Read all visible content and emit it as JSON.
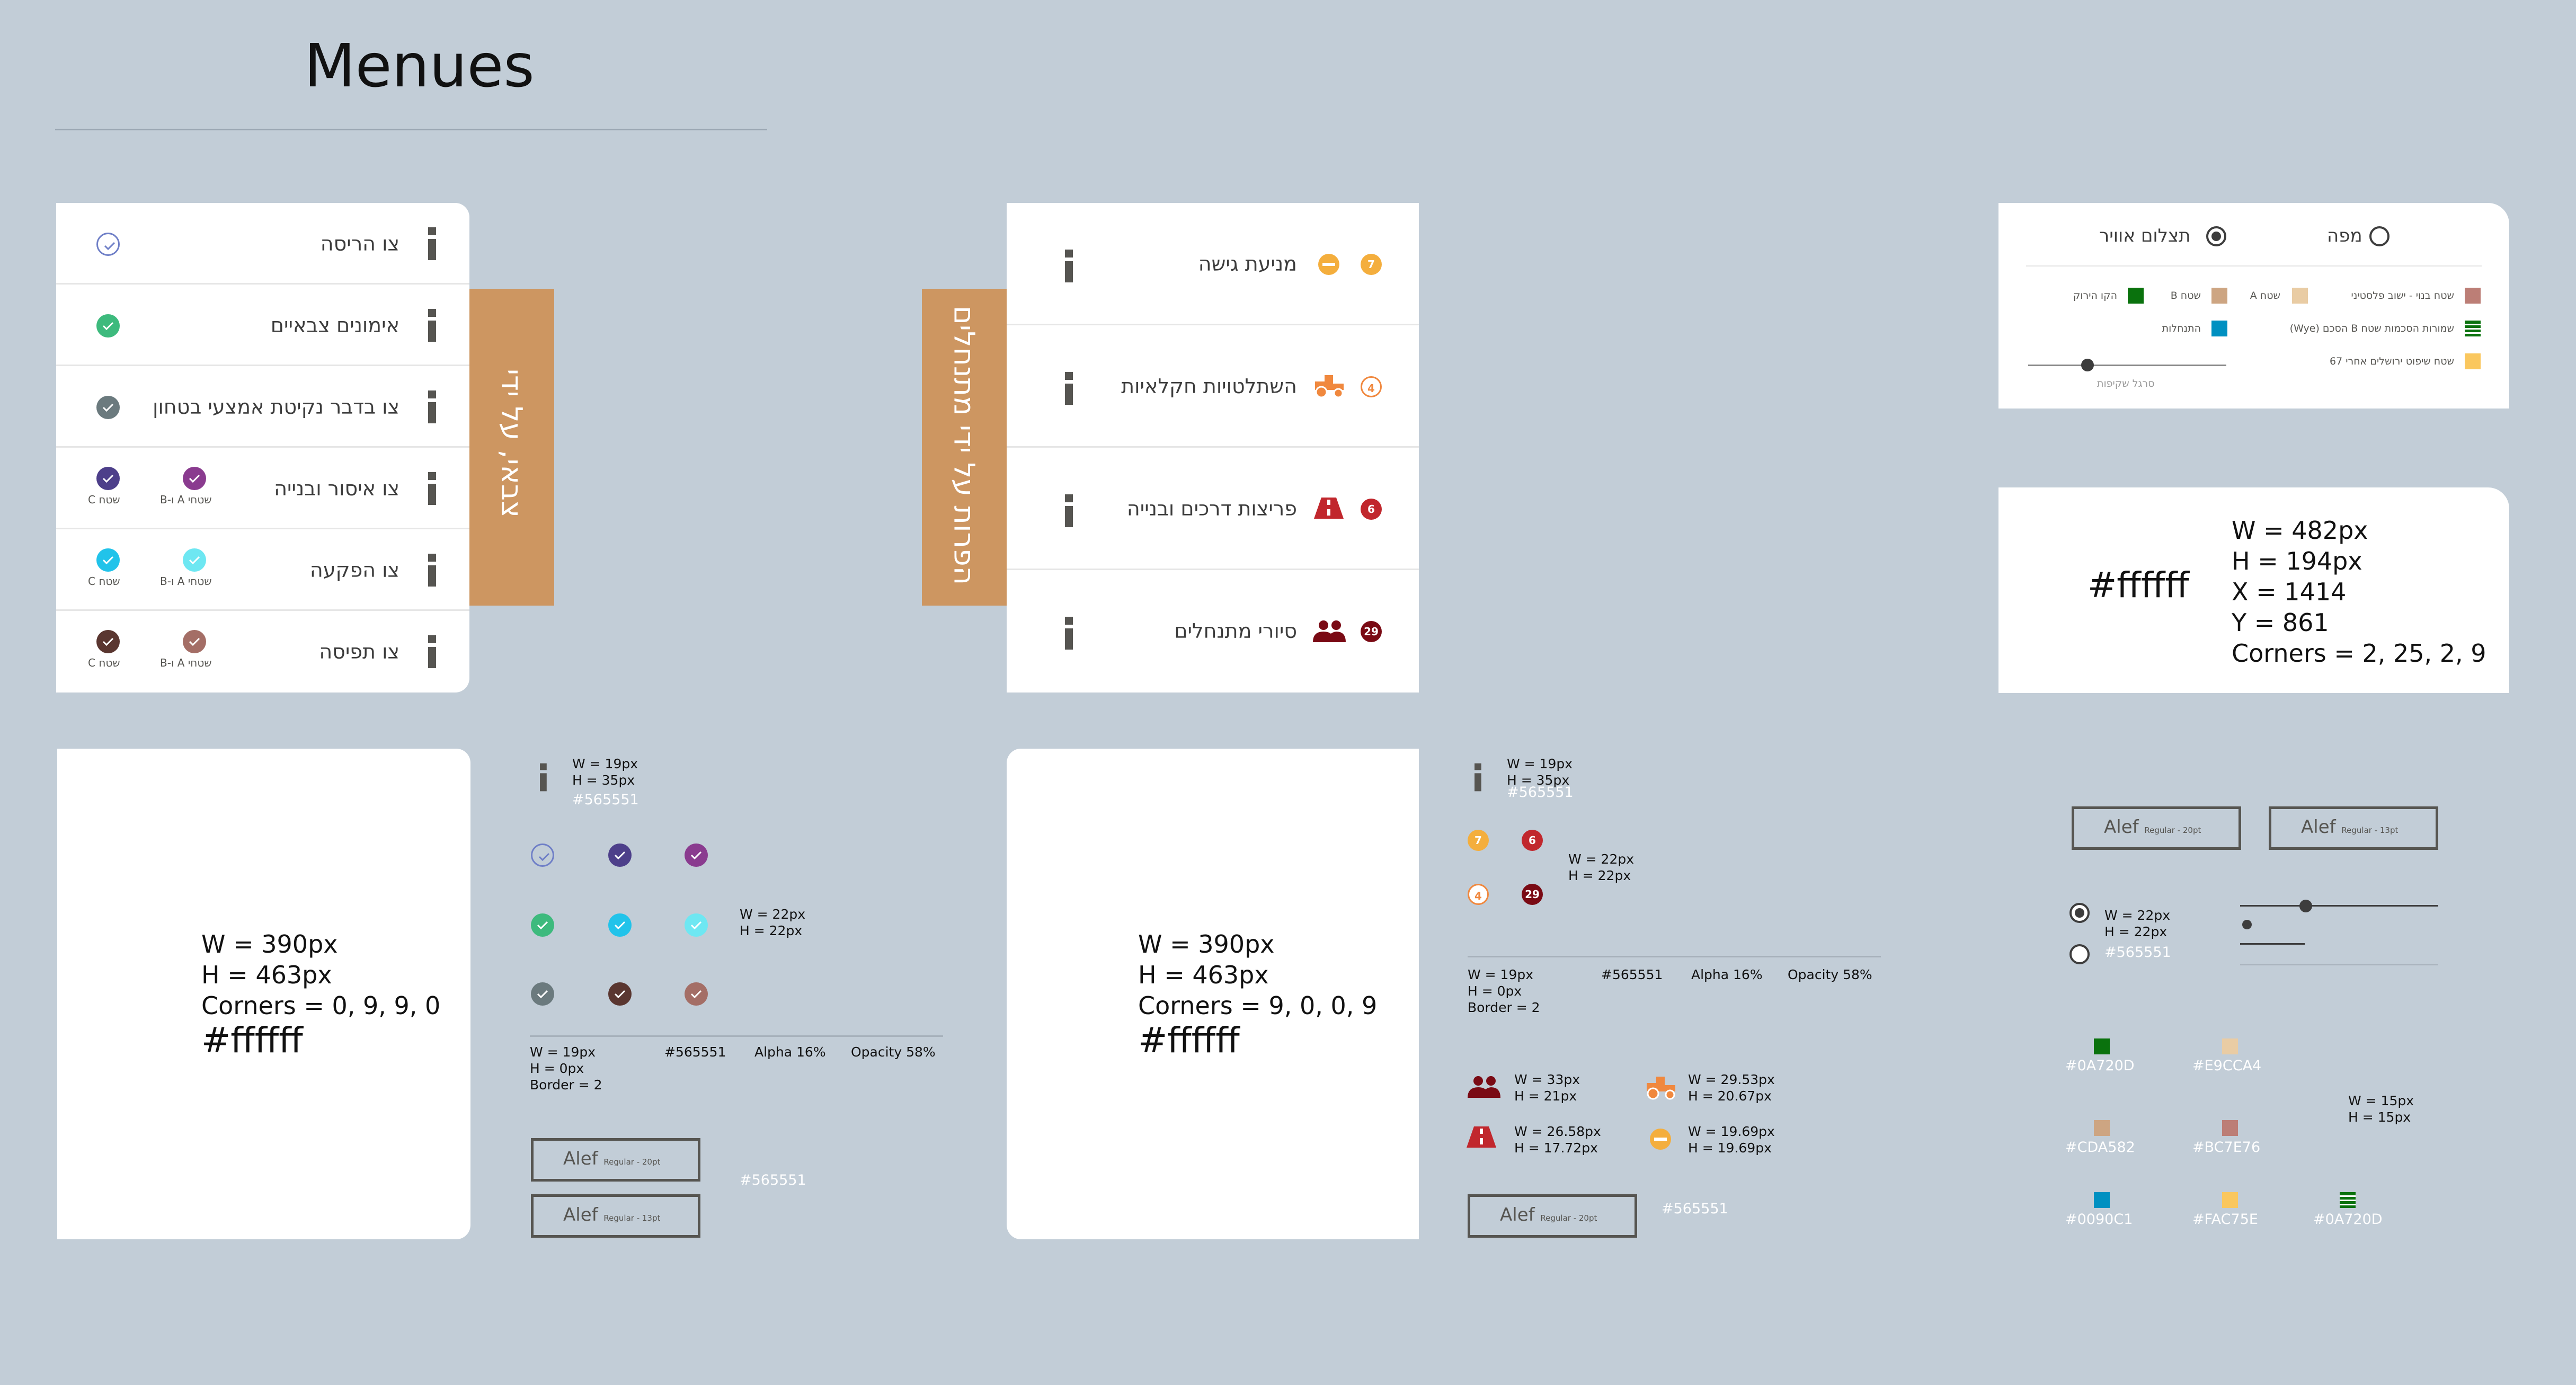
{
  "page": {
    "title": "Menues"
  },
  "menu1": {
    "tab_label": "צבאי, על ידי",
    "rows": [
      {
        "label": "צו הריסה",
        "icon": "check-outline-icon"
      },
      {
        "label": "אימונים צבאיים",
        "icon": "check-green-icon"
      },
      {
        "label": "צו בדבר נקיטת אמצעי בטחון",
        "icon": "check-gray-icon"
      },
      {
        "label": "צו איסור ובנייה",
        "sub_a": "שטחי A ו-B",
        "sub_c": "שטח C"
      },
      {
        "label": "צו הפקעה",
        "sub_a": "שטחי A ו-B",
        "sub_c": "שטח C"
      },
      {
        "label": "צו תפיסה",
        "sub_a": "שטחי A ו-B",
        "sub_c": "שטח C"
      }
    ]
  },
  "menu2": {
    "tab_label": "הפרות על ידי מתנחלים",
    "rows": [
      {
        "label": "מניעת גישה",
        "badge": "7"
      },
      {
        "label": "השתלטויות חקלאיות",
        "badge": "4"
      },
      {
        "label": "פריצות דרכים ובנייה",
        "badge": "6"
      },
      {
        "label": "סיורי מתנחלים",
        "badge": "29"
      }
    ]
  },
  "layers": {
    "radio_aerial": "תצלום אוויר",
    "radio_map": "מפה",
    "legend": [
      {
        "label": "שטח בנוי - ישוב פלסטיני",
        "color": "#BC7E76"
      },
      {
        "label": "שטח A",
        "color": "#E9CCA4"
      },
      {
        "label": "שטח B",
        "color": "#CDA582"
      },
      {
        "label": "הקו הירוק",
        "color": "#0A720D"
      },
      {
        "label": "שמורות הסכמות שטח B הסכם (Wye)",
        "color": "#0A720D"
      },
      {
        "label": "התנחלות",
        "color": "#0090C1"
      },
      {
        "label": "שטח שיפוט ירושלים אחרי 67",
        "color": "#FAC75E"
      }
    ],
    "slider_label": "סרגל שקיפות",
    "slider_value": 0.3
  },
  "layers_spec": {
    "hex": "#ffffff",
    "lines": [
      "W = 482px",
      "H = 194px",
      "X = 1414",
      "Y = 861",
      "Corners = 2, 25, 2, 9"
    ]
  },
  "spec_left": {
    "lines": [
      "W = 390px",
      "H = 463px",
      "Corners = 0, 9, 9, 0"
    ],
    "hex": "#ffffff"
  },
  "spec_mid": {
    "lines": [
      "W = 390px",
      "H = 463px",
      "Corners = 9, 0, 0, 9"
    ],
    "hex": "#ffffff"
  },
  "notes": {
    "i_w": "W = 19px",
    "i_h": "H = 35px",
    "i_hex": "#565551",
    "chk_w": "W = 22px",
    "chk_h": "H = 22px",
    "div_w": "W = 19px",
    "div_h": "H = 0px",
    "div_border": "Border = 2",
    "div_hex": "#565551",
    "alpha": "Alpha 16%",
    "opacity": "Opacity 58%",
    "font_name": "Alef",
    "font_20": "Regular - 20pt",
    "font_13": "Regular - 13pt",
    "font_hex": "#565551",
    "settlers_w": "W = 33px",
    "settlers_h": "H = 21px",
    "road_w": "W = 26.58px",
    "road_h": "H = 17.72px",
    "tractor_w": "W = 29.53px",
    "tractor_h": "H = 20.67px",
    "block_w": "W = 19.69px",
    "block_h": "H = 19.69px",
    "radio_w": "W = 22px",
    "radio_h": "H = 22px",
    "radio_hex": "#565551",
    "sw_w": "W = 15px",
    "sw_h": "H = 15px"
  },
  "swatches": [
    {
      "hex": "#0A720D",
      "color": "#0A720D"
    },
    {
      "hex": "#E9CCA4",
      "color": "#E9CCA4"
    },
    {
      "hex": "#CDA582",
      "color": "#CDA582"
    },
    {
      "hex": "#BC7E76",
      "color": "#BC7E76"
    },
    {
      "hex": "#0090C1",
      "color": "#0090C1"
    },
    {
      "hex": "#FAC75E",
      "color": "#FAC75E"
    },
    {
      "hex": "#0A720D",
      "color": "#0A720D"
    }
  ],
  "colors": {
    "tab": "#CD9661",
    "panel": "#ffffff",
    "background": "#C2CDD7",
    "text": "#565551",
    "badge_yellow": "#F4AE3D",
    "badge_orange": "#F0883E",
    "badge_red": "#C1272D",
    "badge_maroon": "#7A0A14"
  }
}
